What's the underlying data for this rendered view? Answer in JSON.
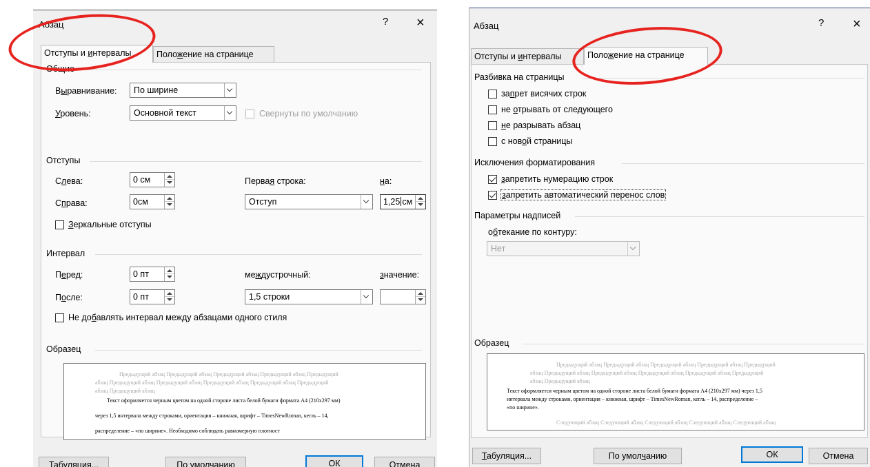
{
  "left": {
    "title": "Абзац",
    "help": "?",
    "close": "×",
    "tabs": {
      "indents": {
        "pre": "Отступы и ",
        "u": "и",
        "post": "нтервалы"
      },
      "position": {
        "pre": "Поло",
        "u": "ж",
        "post": "ение на странице"
      }
    },
    "general": {
      "title": "Общие",
      "align_label": {
        "pre": "В",
        "u": "ы",
        "post": "равнивание:"
      },
      "align_value": "По ширине",
      "level_label": {
        "pre": "",
        "u": "У",
        "post": "ровень:"
      },
      "level_value": "Основной текст",
      "collapsed_label": "Свернуты по умолчанию"
    },
    "indents": {
      "title": "Отступы",
      "left_label": {
        "pre": "С",
        "u": "л",
        "post": "ева:"
      },
      "left_value": "0 см",
      "right_label": {
        "pre": "С",
        "u": "п",
        "post": "рава:"
      },
      "right_value": "0см",
      "first_line_label": {
        "pre": "Перва",
        "u": "я",
        "post": " строка:"
      },
      "first_line_value": "Отступ",
      "by_label": {
        "pre": "",
        "u": "н",
        "post": "а:"
      },
      "by_value": "1,25",
      "by_unit": "см",
      "mirror_label": {
        "pre": "",
        "u": "З",
        "post": "еркальные отступы"
      }
    },
    "spacing": {
      "title": "Интервал",
      "before_label": {
        "pre": "П",
        "u": "е",
        "post": "ред:"
      },
      "before_value": "0 пт",
      "after_label": {
        "pre": "П",
        "u": "о",
        "post": "сле:"
      },
      "after_value": "0 пт",
      "line_label": {
        "pre": "ме",
        "u": "ж",
        "post": "дустрочный:"
      },
      "line_value": "1,5 строки",
      "value_label": {
        "pre": "",
        "u": "з",
        "post": "начение:"
      },
      "value_value": "",
      "dont_add_label": {
        "pre": "Не до",
        "u": "б",
        "post": "авлять интервал между абзацами одного стиля"
      }
    },
    "preview": {
      "title": "Образец",
      "prev1": "Предыдущий абзац Предыдущий абзац Предыдущий абзац Предыдущий абзац Предыдущий",
      "prev2": "абзац Предыдущий абзац Предыдущий абзац Предыдущий абзац Предыдущий абзац Предыдущий",
      "prev3": "абзац Предыдущий абзац",
      "cur1": "Текст оформляется черным цветом на одной стороне листа белой бумаги формата А4 (210х297 мм)",
      "cur2": "через 1,5 интервала между строками, ориентация – книжная, шрифт – TimesNewRoman, кегль – 14,",
      "cur3": "распределение – «по ширине». Необходимо соблюдать равномерную плотност"
    },
    "buttons": {
      "tabs": {
        "pre": "",
        "u": "Т",
        "post": "абуляция..."
      },
      "default": {
        "pre": "По умол",
        "u": "ч",
        "post": "анию"
      },
      "ok": "ОК",
      "cancel": "Отмена"
    }
  },
  "right": {
    "title": "Абзац",
    "help": "?",
    "close": "×",
    "tabs": {
      "indents": {
        "pre": "Отступы и ",
        "u": "и",
        "post": "нтервалы"
      },
      "position": {
        "pre": "Поло",
        "u": "ж",
        "post": "ение на странице"
      }
    },
    "pagination": {
      "title": "Разбивка на страницы",
      "widow": {
        "pre": "за",
        "u": "п",
        "post": "рет висячих строк"
      },
      "keep_next": {
        "pre": "не ",
        "u": "о",
        "post": "трывать от следующего"
      },
      "keep_lines": {
        "pre": "",
        "u": "н",
        "post": "е разрывать абзац"
      },
      "page_break": {
        "pre": "с нов",
        "u": "о",
        "post": "й страницы"
      }
    },
    "exceptions": {
      "title": "Исключения форматирования",
      "suppress_numbers": {
        "pre": "",
        "u": "з",
        "post": "апретить нумерацию строк"
      },
      "no_hyphen": {
        "pre": "",
        "u": "з",
        "post": "апретить автоматический перенос слов"
      }
    },
    "textbox": {
      "title": "Параметры надписей",
      "wrap_label": {
        "pre": "о",
        "u": "б",
        "post": "текание по контуру:"
      },
      "wrap_value": "Нет"
    },
    "preview": {
      "title": "Образец",
      "prev1": "Предыдущий абзац Предыдущий абзац Предыдущий абзац Предыдущий абзац Предыдущий",
      "prev2": "абзац Предыдущий абзац Предыдущий абзац Предыдущий абзац Предыдущий абзац Предыдущий",
      "prev3": "абзац Предыдущий абзац",
      "cur1": "Текст оформляется черным цветом на одной стороне листа белой бумаги формата А4 (210х297 мм) через 1,5",
      "cur2": "интервала между строками, ориентация – книжная, шрифт – TimesNewRoman, кегль – 14, распределение –",
      "cur3": "«по ширине».",
      "next1": "Следующий абзац Следующий абзац Следующий абзац Следующий абзац Следующий абзац"
    },
    "buttons": {
      "tabs": {
        "pre": "",
        "u": "Т",
        "post": "абуляция..."
      },
      "default": {
        "pre": "По умол",
        "u": "ч",
        "post": "анию"
      },
      "ok": "ОК",
      "cancel": "Отмена"
    }
  },
  "colors": {
    "annotation": "#e6231f",
    "default_button_border": "#0078d7"
  }
}
